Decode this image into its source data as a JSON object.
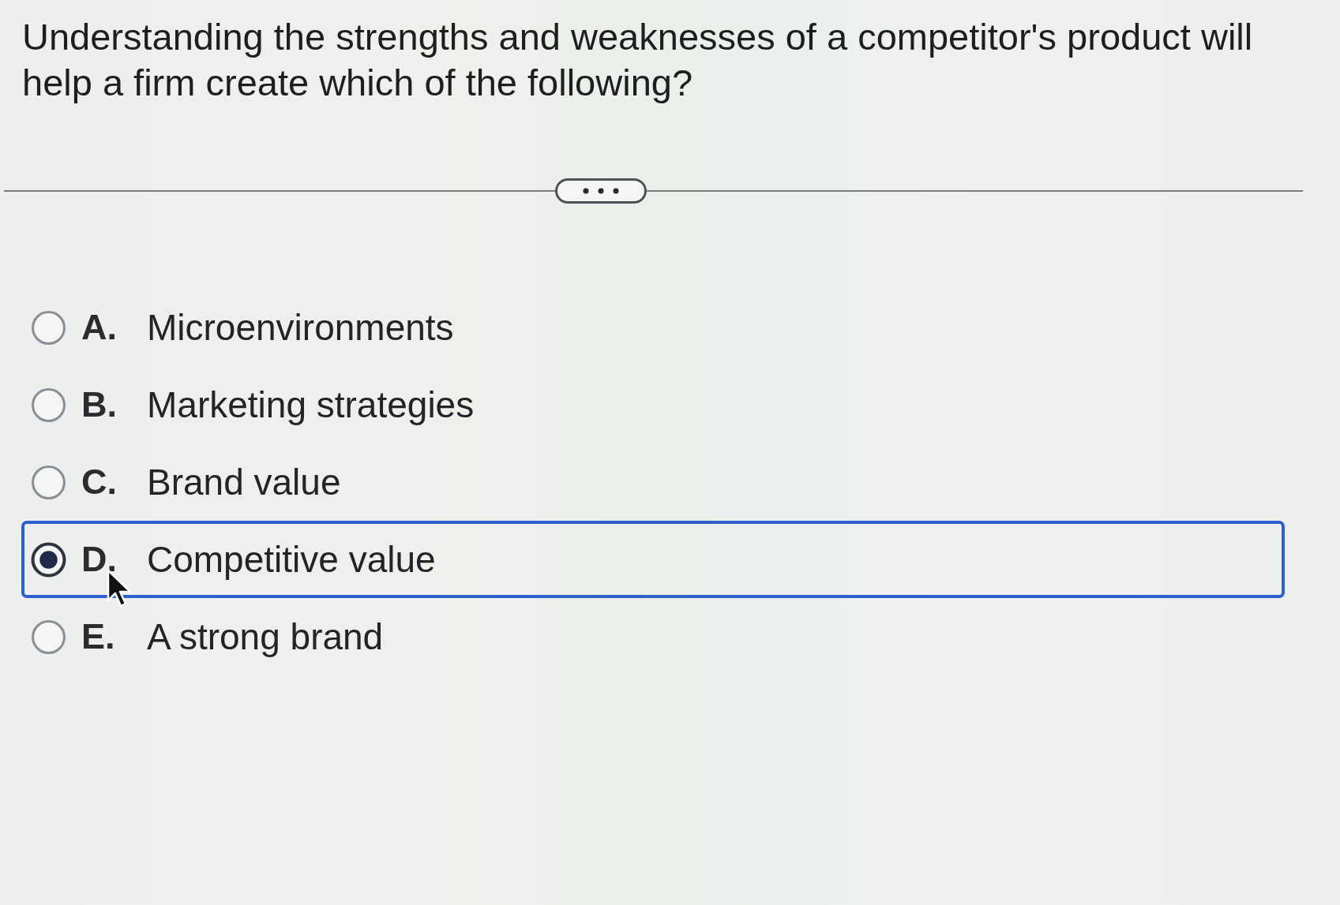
{
  "question": {
    "text": "Understanding the strengths and weaknesses of a competitor's product will help a firm create which of the following?"
  },
  "options": [
    {
      "letter": "A.",
      "label": "Microenvironments",
      "selected": false
    },
    {
      "letter": "B.",
      "label": "Marketing strategies",
      "selected": false
    },
    {
      "letter": "C.",
      "label": "Brand value",
      "selected": false
    },
    {
      "letter": "D.",
      "label": "Competitive value",
      "selected": true
    },
    {
      "letter": "E.",
      "label": "A strong brand",
      "selected": false
    }
  ]
}
